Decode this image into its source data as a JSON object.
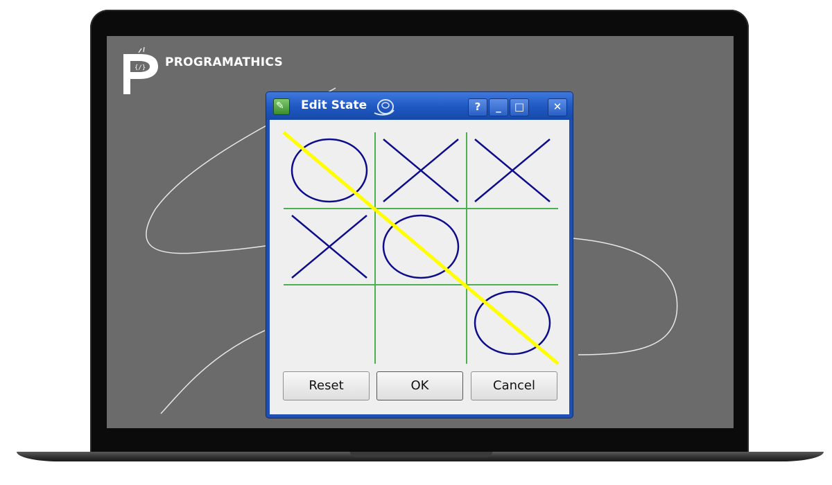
{
  "brand": {
    "name": "PROGRAMATHICS"
  },
  "dialog": {
    "title": "Edit State",
    "title_buttons": {
      "help": "?",
      "minimize": "_",
      "maximize": "□",
      "close": "✕"
    },
    "buttons": {
      "reset": "Reset",
      "ok": "OK",
      "cancel": "Cancel"
    }
  },
  "board": {
    "cells": [
      "O",
      "X",
      "X",
      "X",
      "O",
      "",
      "",
      "",
      "O"
    ],
    "winning_line": "diagonal",
    "colors": {
      "grid": "#4caf50",
      "mark": "#0d0d8c",
      "win_line": "#ffff00"
    }
  },
  "colors": {
    "titlebar": "#1f57c2",
    "screen": "#6b6b6b",
    "content": "#efefef"
  }
}
